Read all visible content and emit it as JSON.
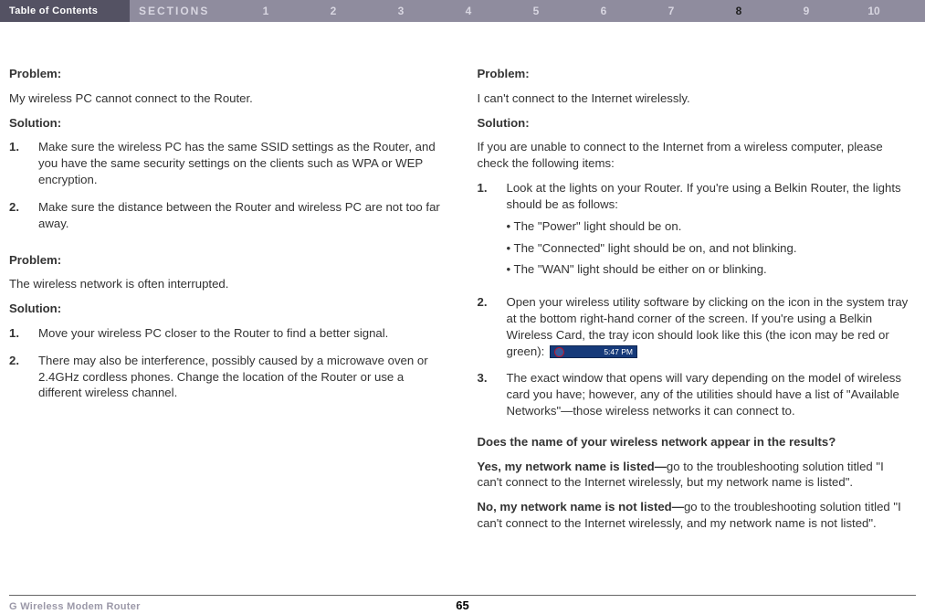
{
  "topbar": {
    "toc": "Table of Contents",
    "sections_label": "SECTIONS",
    "sections": [
      "1",
      "2",
      "3",
      "4",
      "5",
      "6",
      "7",
      "8",
      "9",
      "10"
    ],
    "active_index": 7
  },
  "leftcol": {
    "p1": {
      "heading": "Problem:",
      "text": "My wireless PC cannot connect to the Router.",
      "solution_label": "Solution:",
      "steps": [
        {
          "num": "1.",
          "text": "Make sure the wireless PC has the same SSID settings as the Router, and you have the same security settings on the clients such as WPA or WEP encryption."
        },
        {
          "num": "2.",
          "text": "Make sure the distance between the Router and wireless PC are not too far away."
        }
      ]
    },
    "p2": {
      "heading": "Problem:",
      "text": "The wireless network is often interrupted.",
      "solution_label": "Solution:",
      "steps": [
        {
          "num": "1.",
          "text": "Move your wireless PC closer to the Router to find a better signal."
        },
        {
          "num": "2.",
          "text": "There may also be interference, possibly caused by a microwave oven or 2.4GHz cordless phones. Change the location of the Router or use a different wireless channel."
        }
      ]
    }
  },
  "rightcol": {
    "p1": {
      "heading": "Problem:",
      "text": "I can't connect to the Internet wirelessly.",
      "solution_label": "Solution:",
      "intro": "If you are unable to connect to the Internet from a wireless computer, please check the following items:",
      "step1": {
        "num": "1.",
        "text": "Look at the lights on your Router. If you're using a Belkin Router, the lights should be as follows:",
        "bullets": [
          "• The \"Power\" light should be on.",
          "• The \"Connected\" light should be on, and not blinking.",
          "• The \"WAN\" light should be either on or blinking."
        ]
      },
      "step2": {
        "num": "2.",
        "text": "Open your wireless utility software by clicking on the icon in the system tray at the bottom right-hand corner of the screen. If you're using a Belkin Wireless Card, the tray icon should look like this (the icon may be red or green):"
      },
      "tray_time": "5:47 PM",
      "step3": {
        "num": "3.",
        "text": "The exact window that opens will vary depending on the model of wireless card you have; however, any of the utilities should have a list of \"Available Networks\"—those wireless networks it can connect to."
      },
      "q": "Does the name of your wireless network appear in the results?",
      "yes_bold": "Yes, my network name is listed—",
      "yes_text": "go to the troubleshooting solution titled \"I can't connect to the Internet wirelessly, but my network name is listed\".",
      "no_bold": "No, my network name is not listed—",
      "no_text": "go to the troubleshooting solution titled \"I can't connect to the Internet wirelessly, and my network name is not listed\"."
    }
  },
  "footer": {
    "product": "G Wireless Modem Router",
    "page": "65"
  }
}
